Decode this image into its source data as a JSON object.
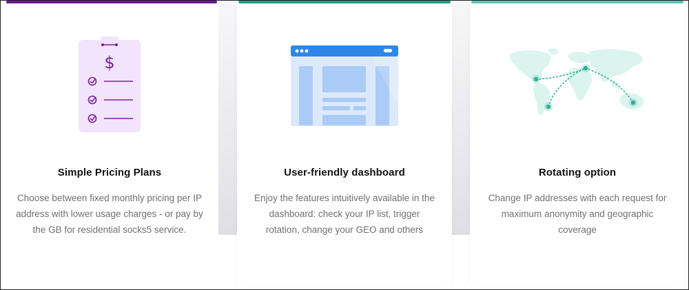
{
  "colors": {
    "pricing_accent": "#7a1ea1",
    "dashboard_accent": "#2b8bea",
    "rotation_accent": "#2bb39a"
  },
  "cards": [
    {
      "icon": "pricing-clipboard-icon",
      "title": "Simple Pricing Plans",
      "description": "Choose between fixed monthly pricing per IP address with lower usage charges - or pay by the GB for residential socks5 service."
    },
    {
      "icon": "dashboard-window-icon",
      "title": "User-friendly dashboard",
      "description": "Enjoy the features intuitively available in the dashboard: check your IP list, trigger rotation, change your GEO and others"
    },
    {
      "icon": "world-map-icon",
      "title": "Rotating option",
      "description": "Change IP addresses with each request for maximum anonymity and geographic coverage"
    }
  ]
}
